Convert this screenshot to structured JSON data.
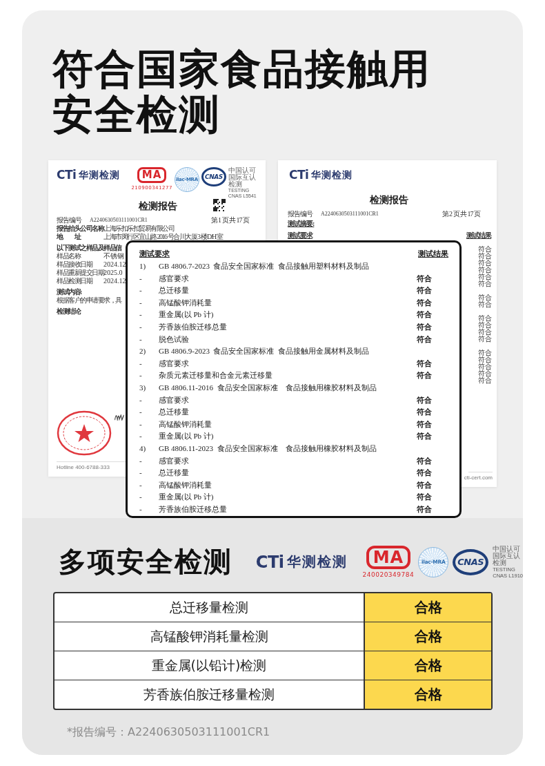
{
  "headline": [
    "符合国家食品接触用",
    "安全检测"
  ],
  "report_page_1": {
    "brand": {
      "mark": "CTi",
      "name": "华测检测"
    },
    "certifications": {
      "cma_mark": "MA",
      "cma_number": "210900341277",
      "ilac": "ilac-MRA",
      "cnas": "CNAS",
      "note": [
        "中国认可",
        "国际互认",
        "检测",
        "TESTING",
        "CNAS L5541"
      ]
    },
    "title": "检测报告",
    "report_no_label": "报告编号",
    "report_no": "A2240630503111001CR1",
    "page": "第 1 页 共 17 页",
    "fields": [
      {
        "label": "报告抬头公司名称",
        "value": "上海乐扣乐扣贸易有限公司"
      },
      {
        "label": "地　　址",
        "value": "上海市闵行区宜山路 2016 号合川大厦 3 楼 D/H 室"
      }
    ],
    "sample_heading": "以下测试之样品及样品信",
    "samples": [
      {
        "label": "样品名称",
        "value": "不锈钢"
      },
      {
        "label": "样品接收日期",
        "value": "2024.12"
      },
      {
        "label": "样品重新提交日期",
        "value": "2025.0"
      },
      {
        "label": "样品检测日期",
        "value": "2024.12"
      }
    ],
    "content_heading": "测试内容:",
    "content_text": "根据客户的申请要求，具",
    "conclusion_heading": "检测结论",
    "footer": "Hotline 400-6788-333"
  },
  "report_page_2": {
    "brand": {
      "mark": "CTi",
      "name": "华测检测"
    },
    "title": "检测报告",
    "report_no_label": "报告编号",
    "report_no": "A2240630503111001CR1",
    "page": "第 2 页 共 17 页",
    "summary_heading": "测试摘要:",
    "requirement_header": "测试要求",
    "result_header": "测试结果",
    "result_groups": [
      [
        "符合",
        "符合",
        "符合",
        "符合",
        "符合",
        "符合"
      ],
      [
        "符合",
        "符合"
      ],
      [
        "符合",
        "符合",
        "符合",
        "符合"
      ],
      [
        "符合",
        "符合",
        "符合",
        "符合",
        "符合"
      ]
    ],
    "footer": "cti-cert.com"
  },
  "zoom_panel": {
    "requirement_header": "测试要求",
    "result_header": "测试结果",
    "rows": [
      {
        "kind": "standard",
        "index": "1)",
        "text": "GB 4806.7-2023  食品安全国家标准  食品接触用塑料材料及制品"
      },
      {
        "kind": "item",
        "index": "-",
        "text": "感官要求",
        "result": "符合"
      },
      {
        "kind": "item",
        "index": "-",
        "text": "总迁移量",
        "result": "符合"
      },
      {
        "kind": "item",
        "index": "-",
        "text": "高锰酸钾消耗量",
        "result": "符合"
      },
      {
        "kind": "item",
        "index": "-",
        "text": "重金属(以 Pb 计)",
        "result": "符合"
      },
      {
        "kind": "item",
        "index": "-",
        "text": "芳香族伯胺迁移总量",
        "result": "符合"
      },
      {
        "kind": "item",
        "index": "-",
        "text": "脱色试验",
        "result": "符合"
      },
      {
        "kind": "standard",
        "index": "2)",
        "text": "GB 4806.9-2023  食品安全国家标准  食品接触用金属材料及制品"
      },
      {
        "kind": "item",
        "index": "-",
        "text": "感官要求",
        "result": "符合"
      },
      {
        "kind": "item",
        "index": "-",
        "text": "杂质元素迁移量和合金元素迁移量",
        "result": "符合"
      },
      {
        "kind": "standard",
        "index": "3)",
        "text": "GB 4806.11-2016  食品安全国家标准    食品接触用橡胶材料及制品"
      },
      {
        "kind": "item",
        "index": "-",
        "text": "感官要求",
        "result": "符合"
      },
      {
        "kind": "item",
        "index": "-",
        "text": "总迁移量",
        "result": "符合"
      },
      {
        "kind": "item",
        "index": "-",
        "text": "高锰酸钾消耗量",
        "result": "符合"
      },
      {
        "kind": "item",
        "index": "-",
        "text": "重金属(以 Pb 计)",
        "result": "符合"
      },
      {
        "kind": "standard",
        "index": "4)",
        "text": "GB 4806.11-2023  食品安全国家标准    食品接触用橡胶材料及制品"
      },
      {
        "kind": "item",
        "index": "-",
        "text": "感官要求",
        "result": "符合"
      },
      {
        "kind": "item",
        "index": "-",
        "text": "总迁移量",
        "result": "符合"
      },
      {
        "kind": "item",
        "index": "-",
        "text": "高锰酸钾消耗量",
        "result": "符合"
      },
      {
        "kind": "item",
        "index": "-",
        "text": "重金属(以 Pb 计)",
        "result": "符合"
      },
      {
        "kind": "item",
        "index": "-",
        "text": "芳香族伯胺迁移总量",
        "result": "符合"
      }
    ]
  },
  "section_title": "多项安全检测",
  "section_brand": {
    "mark": "CTi",
    "name": "华测检测"
  },
  "section_certifications": {
    "cma_mark": "MA",
    "cma_number": "240020349784",
    "ilac": "ilac-MRA",
    "cnas": "CNAS",
    "note": [
      "中国认可",
      "国际互认",
      "检测",
      "TESTING",
      "CNAS L1910"
    ]
  },
  "results": [
    {
      "test": "总迁移量检测",
      "result": "合格"
    },
    {
      "test": "高锰酸钾消耗量检测",
      "result": "合格"
    },
    {
      "test": "重金属(以铅计)检测",
      "result": "合格"
    },
    {
      "test": "芳香族伯胺迁移量检测",
      "result": "合格"
    }
  ],
  "footnote": "*报告编号：A2240630503111001CR1"
}
